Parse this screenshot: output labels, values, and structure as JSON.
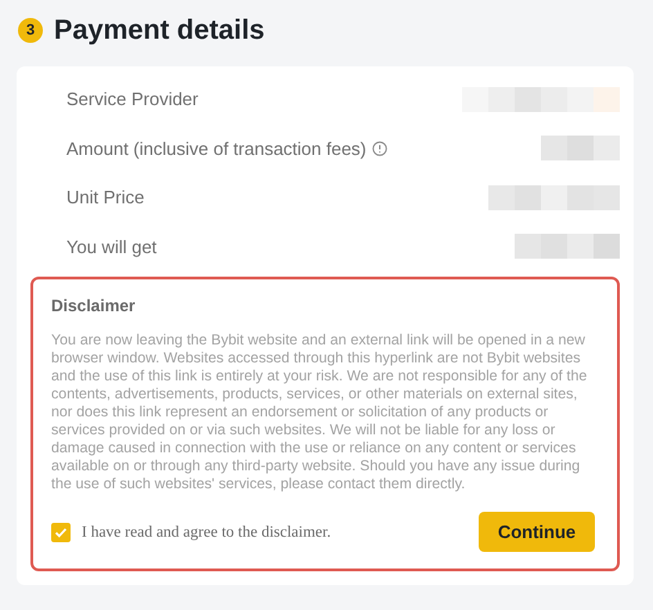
{
  "header": {
    "step": "3",
    "title": "Payment details"
  },
  "details": [
    {
      "label": "Service Provider",
      "info": false
    },
    {
      "label": "Amount (inclusive of transaction fees)",
      "info": true
    },
    {
      "label": "Unit Price",
      "info": false
    },
    {
      "label": "You will get",
      "info": false
    }
  ],
  "disclaimer": {
    "title": "Disclaimer",
    "text": "You are now leaving the Bybit website and an external link will be opened in a new browser window. Websites accessed through this hyperlink are not Bybit websites and the use of this link is entirely at your risk. We are not responsible for any of the contents, advertisements, products, services, or other materials on external sites, nor does this link represent an endorsement or solicitation of any products or services provided on or via such websites. We will not be liable for any loss or damage caused in connection with the use or reliance on any content or services available on or through any third-party website. Should you have any issue during the use of such websites' services, please contact them directly.",
    "agree": {
      "label": "I have read and agree to the disclaimer.",
      "checked": true
    },
    "button": "Continue"
  }
}
